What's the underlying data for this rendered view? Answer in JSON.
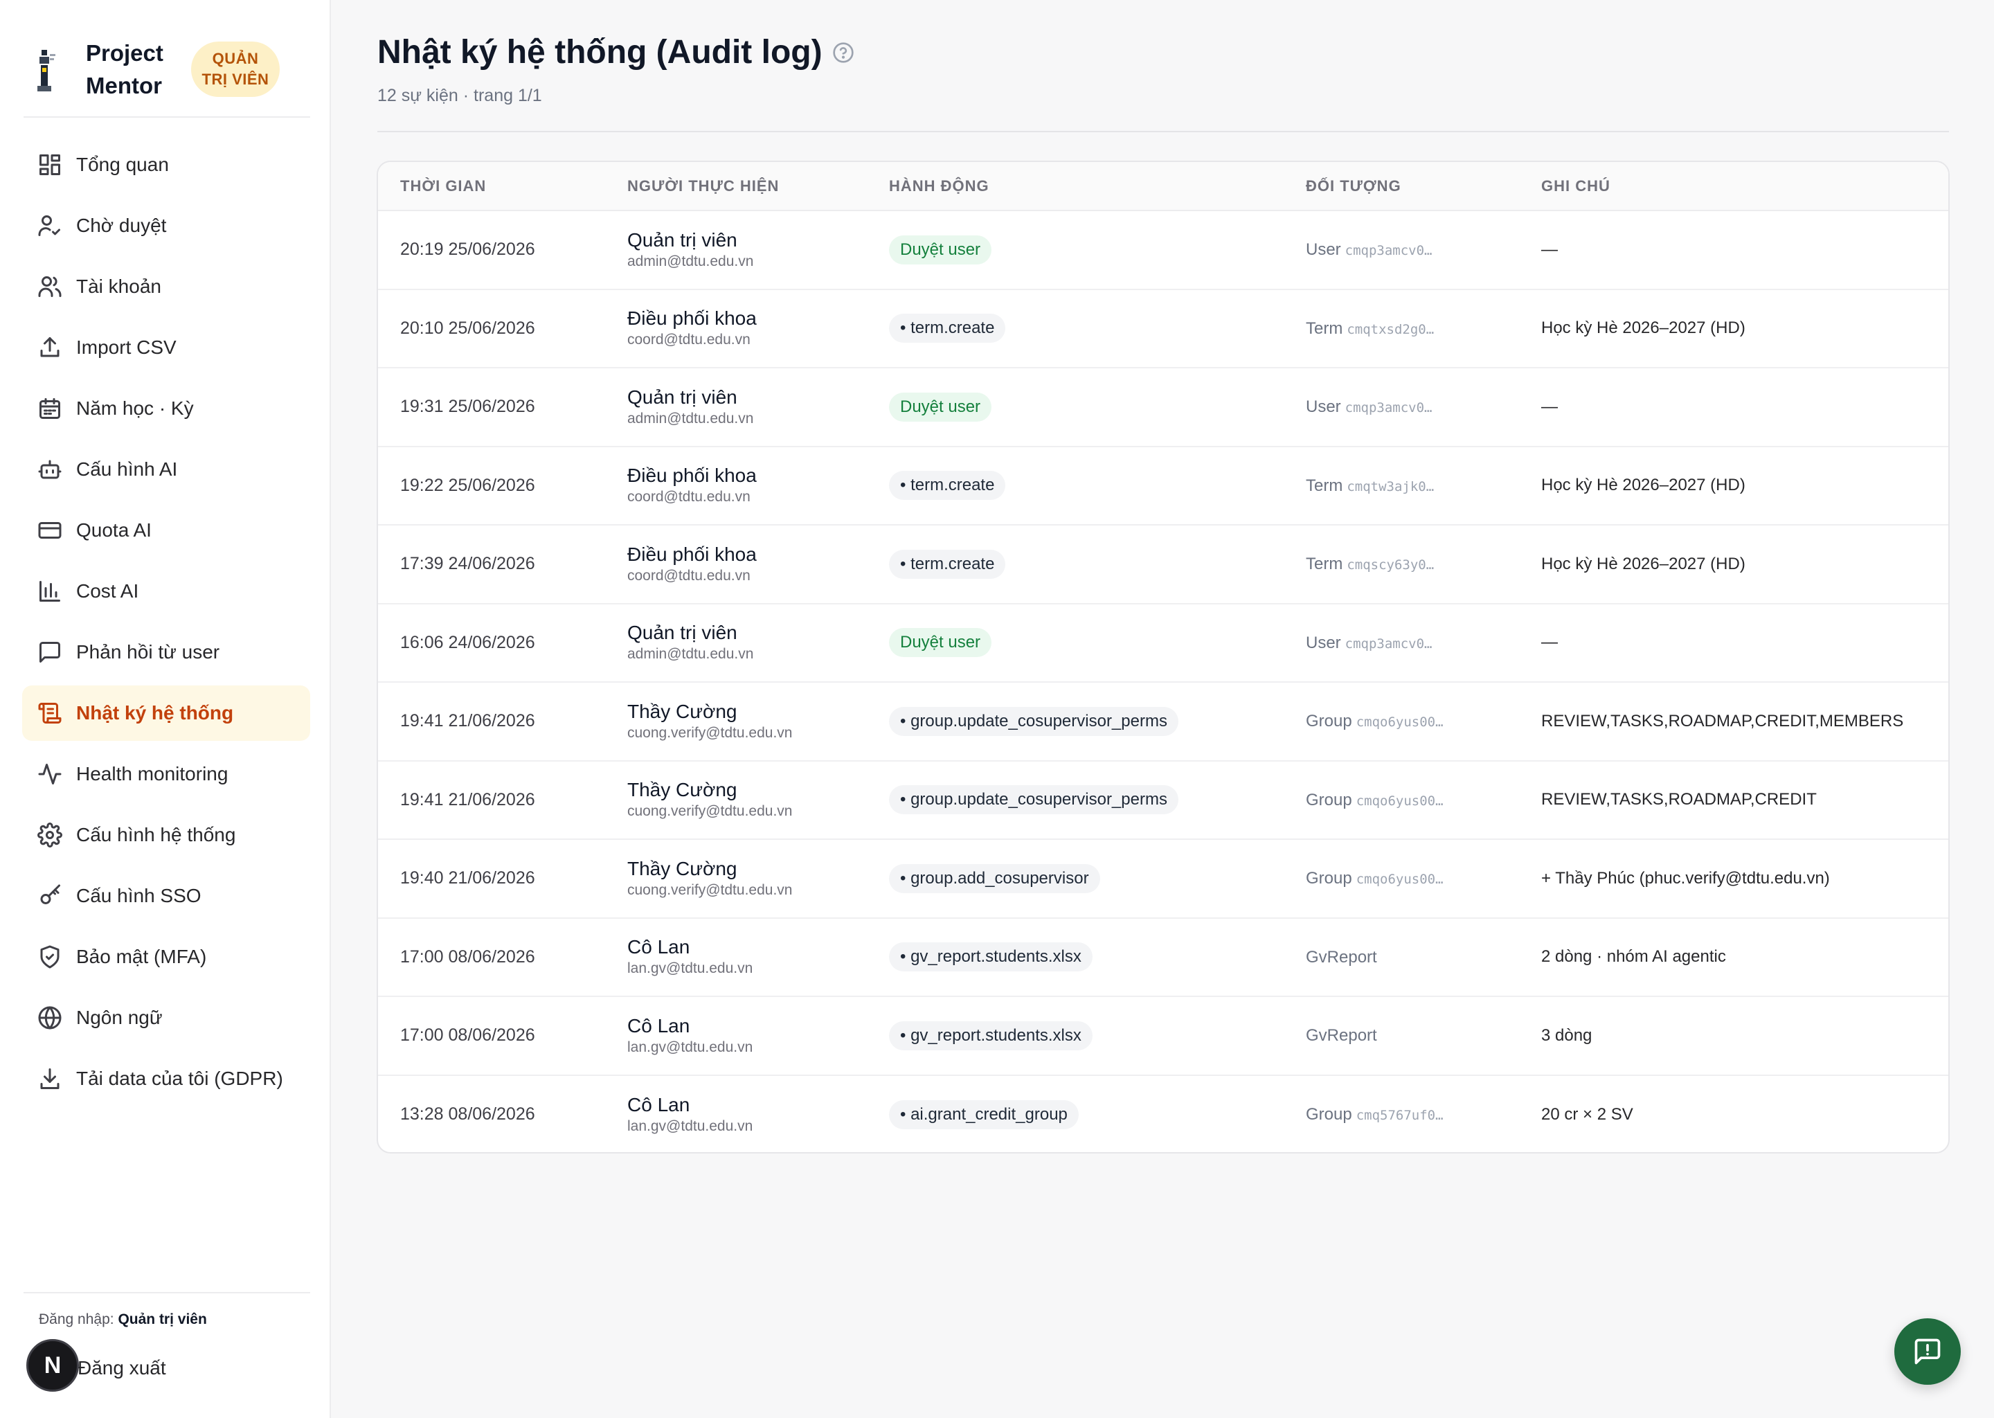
{
  "brand": {
    "name": "Project Mentor",
    "role_badge": "QUẢN TRỊ VIÊN"
  },
  "sidebar": {
    "items": [
      {
        "label": "Tổng quan",
        "icon": "dashboard-icon"
      },
      {
        "label": "Chờ duyệt",
        "icon": "user-check-icon"
      },
      {
        "label": "Tài khoản",
        "icon": "users-icon"
      },
      {
        "label": "Import CSV",
        "icon": "upload-icon"
      },
      {
        "label": "Năm học · Kỳ",
        "icon": "calendar-icon"
      },
      {
        "label": "Cấu hình AI",
        "icon": "bot-icon"
      },
      {
        "label": "Quota AI",
        "icon": "credit-card-icon"
      },
      {
        "label": "Cost AI",
        "icon": "bar-chart-icon"
      },
      {
        "label": "Phản hồi từ user",
        "icon": "message-square-icon"
      },
      {
        "label": "Nhật ký hệ thống",
        "icon": "scroll-icon",
        "active": true
      },
      {
        "label": "Health monitoring",
        "icon": "activity-icon"
      },
      {
        "label": "Cấu hình hệ thống",
        "icon": "settings-icon"
      },
      {
        "label": "Cấu hình SSO",
        "icon": "key-icon"
      },
      {
        "label": "Bảo mật (MFA)",
        "icon": "shield-check-icon"
      },
      {
        "label": "Ngôn ngữ",
        "icon": "globe-icon"
      },
      {
        "label": "Tải data của tôi (GDPR)",
        "icon": "download-icon"
      }
    ],
    "login_prefix": "Đăng nhập:",
    "login_user": "Quản trị viên",
    "logout_label": "Đăng xuất",
    "avatar_letter": "N"
  },
  "page": {
    "title": "Nhật ký hệ thống (Audit log)",
    "subtitle": "12 sự kiện · trang 1/1"
  },
  "table": {
    "columns": [
      "THỜI GIAN",
      "NGƯỜI THỰC HIỆN",
      "HÀNH ĐỘNG",
      "ĐỐI TƯỢNG",
      "GHI CHÚ"
    ],
    "rows": [
      {
        "time": "20:19 25/06/2026",
        "actor": "Quản trị viên",
        "email": "admin@tdtu.edu.vn",
        "action": "Duyệt user",
        "action_kind": "approve",
        "object_type": "User",
        "object_id": "cmqp3amcv0…",
        "note": "—"
      },
      {
        "time": "20:10 25/06/2026",
        "actor": "Điều phối khoa",
        "email": "coord@tdtu.edu.vn",
        "action": "• term.create",
        "action_kind": "code",
        "object_type": "Term",
        "object_id": "cmqtxsd2g0…",
        "note": "Học kỳ Hè 2026–2027 (HD)"
      },
      {
        "time": "19:31 25/06/2026",
        "actor": "Quản trị viên",
        "email": "admin@tdtu.edu.vn",
        "action": "Duyệt user",
        "action_kind": "approve",
        "object_type": "User",
        "object_id": "cmqp3amcv0…",
        "note": "—"
      },
      {
        "time": "19:22 25/06/2026",
        "actor": "Điều phối khoa",
        "email": "coord@tdtu.edu.vn",
        "action": "• term.create",
        "action_kind": "code",
        "object_type": "Term",
        "object_id": "cmqtw3ajk0…",
        "note": "Học kỳ Hè 2026–2027 (HD)"
      },
      {
        "time": "17:39 24/06/2026",
        "actor": "Điều phối khoa",
        "email": "coord@tdtu.edu.vn",
        "action": "• term.create",
        "action_kind": "code",
        "object_type": "Term",
        "object_id": "cmqscy63y0…",
        "note": "Học kỳ Hè 2026–2027 (HD)"
      },
      {
        "time": "16:06 24/06/2026",
        "actor": "Quản trị viên",
        "email": "admin@tdtu.edu.vn",
        "action": "Duyệt user",
        "action_kind": "approve",
        "object_type": "User",
        "object_id": "cmqp3amcv0…",
        "note": "—"
      },
      {
        "time": "19:41 21/06/2026",
        "actor": "Thầy Cường",
        "email": "cuong.verify@tdtu.edu.vn",
        "action": "• group.update_cosupervisor_perms",
        "action_kind": "code",
        "object_type": "Group",
        "object_id": "cmqo6yus00…",
        "note": "REVIEW,TASKS,ROADMAP,CREDIT,MEMBERS"
      },
      {
        "time": "19:41 21/06/2026",
        "actor": "Thầy Cường",
        "email": "cuong.verify@tdtu.edu.vn",
        "action": "• group.update_cosupervisor_perms",
        "action_kind": "code",
        "object_type": "Group",
        "object_id": "cmqo6yus00…",
        "note": "REVIEW,TASKS,ROADMAP,CREDIT"
      },
      {
        "time": "19:40 21/06/2026",
        "actor": "Thầy Cường",
        "email": "cuong.verify@tdtu.edu.vn",
        "action": "• group.add_cosupervisor",
        "action_kind": "code",
        "object_type": "Group",
        "object_id": "cmqo6yus00…",
        "note": "+ Thầy Phúc (phuc.verify@tdtu.edu.vn)"
      },
      {
        "time": "17:00 08/06/2026",
        "actor": "Cô Lan",
        "email": "lan.gv@tdtu.edu.vn",
        "action": "• gv_report.students.xlsx",
        "action_kind": "code",
        "object_type": "GvReport",
        "object_id": "",
        "note": "2 dòng · nhóm AI agentic"
      },
      {
        "time": "17:00 08/06/2026",
        "actor": "Cô Lan",
        "email": "lan.gv@tdtu.edu.vn",
        "action": "• gv_report.students.xlsx",
        "action_kind": "code",
        "object_type": "GvReport",
        "object_id": "",
        "note": "3 dòng"
      },
      {
        "time": "13:28 08/06/2026",
        "actor": "Cô Lan",
        "email": "lan.gv@tdtu.edu.vn",
        "action": "• ai.grant_credit_group",
        "action_kind": "code",
        "object_type": "Group",
        "object_id": "cmq5767uf0…",
        "note": "20 cr × 2 SV"
      }
    ]
  },
  "fab": {
    "icon": "message-alert-icon"
  },
  "colors": {
    "accent": "#c2410c",
    "active_bg": "#fef8e4",
    "badge_bg": "#fdf0c7",
    "approve_green": "#15803d",
    "fab_green": "#1f6b3e"
  }
}
